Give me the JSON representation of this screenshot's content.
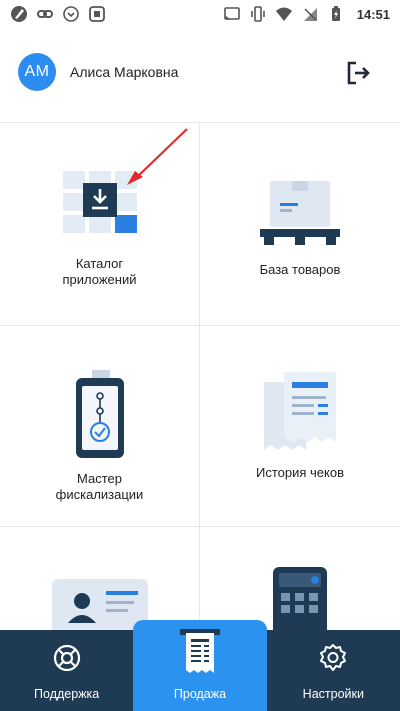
{
  "status_bar": {
    "time": "14:51",
    "left_icons": [
      "edit-icon",
      "link-icon",
      "chevron-circle-icon",
      "square-app-icon"
    ],
    "right_icons": [
      "cast-icon",
      "vibrate-icon",
      "wifi-icon",
      "no-sim-icon",
      "battery-icon"
    ]
  },
  "header": {
    "avatar_initials": "АМ",
    "user_name": "Алиса Марковна",
    "logout_icon": "logout-icon",
    "avatar_color": "#2d8cf0"
  },
  "grid": {
    "items": [
      {
        "label": "Каталог\nприложений",
        "icon": "app-catalog-icon"
      },
      {
        "label": "База товаров",
        "icon": "goods-base-icon"
      },
      {
        "label": "Мастер\nфискализации",
        "icon": "fiscal-master-icon"
      },
      {
        "label": "История чеков",
        "icon": "receipt-history-icon"
      },
      {
        "label": "",
        "icon": "id-card-icon"
      },
      {
        "label": "",
        "icon": "calculator-icon"
      }
    ]
  },
  "bottom_nav": {
    "items": [
      {
        "label": "Поддержка",
        "icon": "lifebuoy-icon"
      },
      {
        "label": "Продажа",
        "icon": "receipt-icon",
        "active": true
      },
      {
        "label": "Настройки",
        "icon": "gear-icon"
      }
    ],
    "background": "#1f3a53",
    "active_color": "#2b92f0"
  }
}
